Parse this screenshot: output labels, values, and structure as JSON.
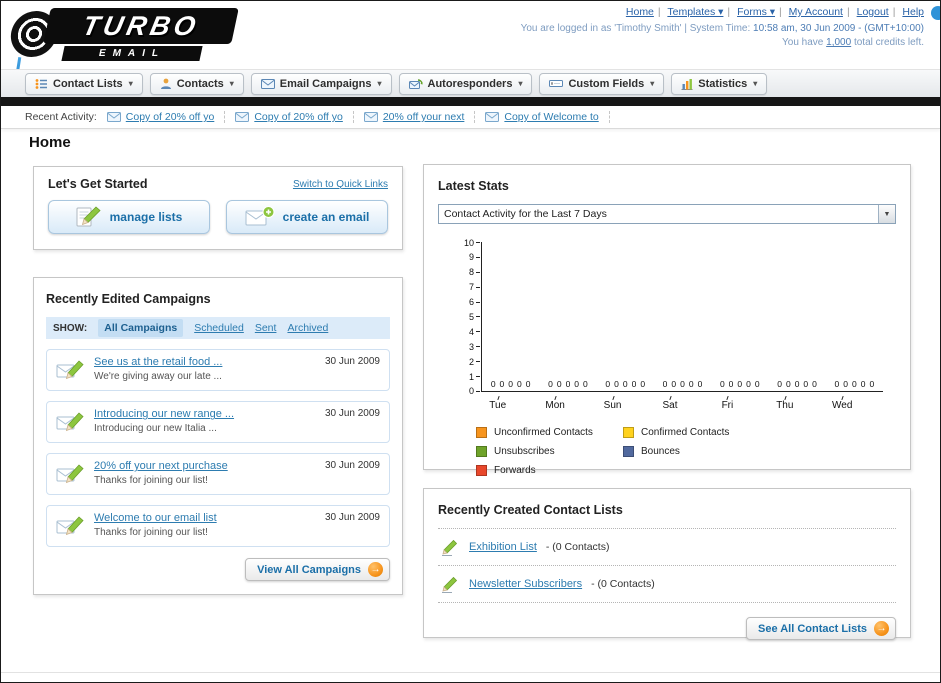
{
  "header": {
    "logo_primary": "TURBO",
    "logo_secondary": "EMAIL",
    "links": [
      {
        "label": "Home"
      },
      {
        "label": "Templates ▾"
      },
      {
        "label": "Forms ▾"
      },
      {
        "label": "My Account"
      },
      {
        "label": "Logout"
      },
      {
        "label": "Help"
      }
    ],
    "session": {
      "prefix": "You are logged in as 'Timothy Smith' | System Time: ",
      "time": "10:58 am, 30 Jun 2009",
      "suffix": " - (GMT+10:00)"
    },
    "credits": {
      "prefix": "You have ",
      "amount": "1,000",
      "suffix": " total credits left."
    }
  },
  "nav": {
    "tabs": [
      {
        "label": "Contact Lists"
      },
      {
        "label": "Contacts"
      },
      {
        "label": "Email Campaigns"
      },
      {
        "label": "Autoresponders"
      },
      {
        "label": "Custom Fields"
      },
      {
        "label": "Statistics"
      }
    ],
    "dropdown_arrow": "▾"
  },
  "activity": {
    "label": "Recent Activity:",
    "items": [
      "Copy of 20% off yo",
      "Copy of 20% off yo",
      "20% off your next",
      "Copy of Welcome to"
    ]
  },
  "page_title": "Home",
  "get_started": {
    "title": "Let's Get Started",
    "switch_link": "Switch to Quick Links",
    "manage_lists_label": "manage lists",
    "create_email_label": "create an email"
  },
  "campaigns": {
    "title": "Recently Edited Campaigns",
    "show_label": "SHOW:",
    "filters": [
      "All Campaigns",
      "Scheduled",
      "Sent",
      "Archived"
    ],
    "items": [
      {
        "title": "See us at the retail food ...",
        "subtitle": "We're giving away our late ...",
        "date": "30 Jun 2009"
      },
      {
        "title": "Introducing our new range ...",
        "subtitle": "Introducing our new Italia ...",
        "date": "30 Jun 2009"
      },
      {
        "title": "20% off your next purchase",
        "subtitle": "Thanks for joining our list!",
        "date": "30 Jun 2009"
      },
      {
        "title": "Welcome to our email list",
        "subtitle": "Thanks for joining our list!",
        "date": "30 Jun 2009"
      }
    ],
    "view_all_label": "View All Campaigns"
  },
  "stats": {
    "title": "Latest Stats",
    "dropdown_value": "Contact Activity for the Last 7 Days",
    "chart_data": {
      "type": "bar",
      "title": "",
      "xlabel": "",
      "ylabel": "",
      "categories": [
        "Tue",
        "Mon",
        "Sun",
        "Sat",
        "Fri",
        "Thu",
        "Wed"
      ],
      "series": [
        {
          "name": "Unconfirmed Contacts",
          "color": "#f7941d",
          "values": [
            0,
            0,
            0,
            0,
            0,
            0,
            0
          ]
        },
        {
          "name": "Confirmed Contacts",
          "color": "#ffd21e",
          "values": [
            0,
            0,
            0,
            0,
            0,
            0,
            0
          ]
        },
        {
          "name": "Unsubscribes",
          "color": "#6fa32a",
          "values": [
            0,
            0,
            0,
            0,
            0,
            0,
            0
          ]
        },
        {
          "name": "Bounces",
          "color": "#51699e",
          "values": [
            0,
            0,
            0,
            0,
            0,
            0,
            0
          ]
        },
        {
          "name": "Forwards",
          "color": "#e8472b",
          "values": [
            0,
            0,
            0,
            0,
            0,
            0,
            0
          ]
        }
      ],
      "ylim": [
        0,
        10
      ],
      "ytick_step": 1,
      "grid": false,
      "legend_position": "bottom"
    }
  },
  "contact_lists": {
    "title": "Recently Created Contact Lists",
    "items": [
      {
        "name": "Exhibition List",
        "suffix": "- (0 Contacts)"
      },
      {
        "name": "Newsletter Subscribers",
        "suffix": "- (0 Contacts)"
      }
    ],
    "see_all_label": "See All Contact Lists"
  },
  "ui": {
    "arrow_glyph": "→",
    "select_arrow": "▼"
  }
}
